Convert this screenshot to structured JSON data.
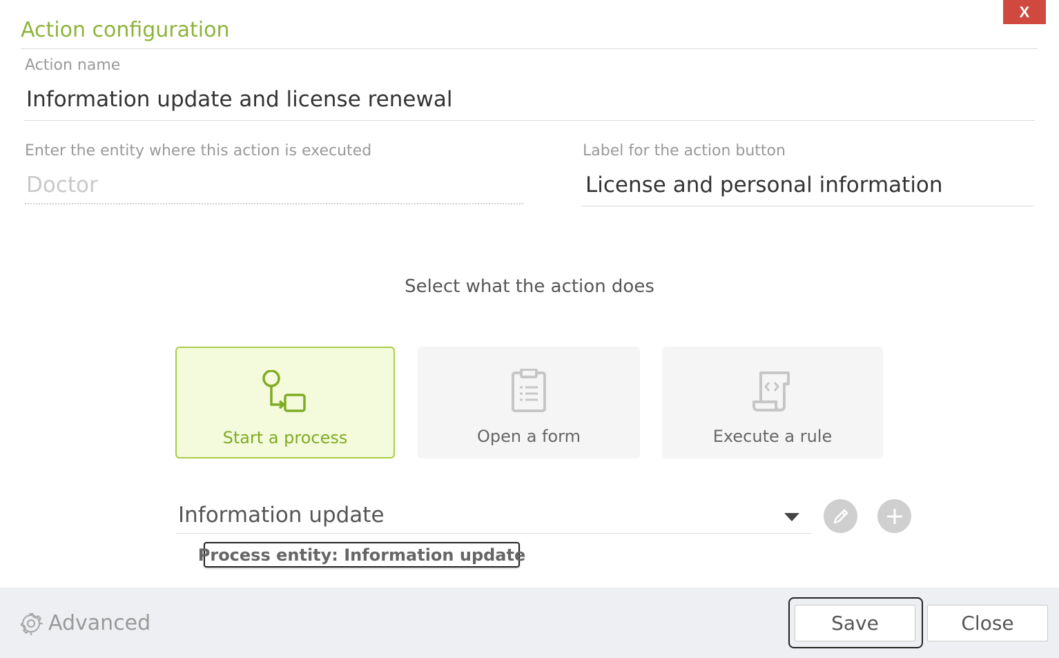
{
  "dialog": {
    "title": "Action configuration",
    "close_label": "X"
  },
  "action_name": {
    "label": "Action name",
    "value": "Information update and license renewal"
  },
  "entity": {
    "label": "Enter the entity where this action is executed",
    "placeholder": "Doctor"
  },
  "button_label": {
    "label": "Label for the action button",
    "value": "License and personal information"
  },
  "action_type": {
    "heading": "Select what the action does",
    "options": [
      {
        "label": "Start a process",
        "icon": "process-icon",
        "selected": true
      },
      {
        "label": "Open a form",
        "icon": "clipboard-icon",
        "selected": false
      },
      {
        "label": "Execute a rule",
        "icon": "script-icon",
        "selected": false
      }
    ]
  },
  "process_select": {
    "value": "Information update",
    "tooltip": "Process entity: Information update"
  },
  "footer": {
    "advanced_label": "Advanced",
    "save_label": "Save",
    "close_label": "Close"
  },
  "colors": {
    "accent_green": "#8cb43a",
    "selected_bg": "#f4fbdc",
    "close_red": "#d0493f",
    "footer_bg": "#eeeff2"
  }
}
